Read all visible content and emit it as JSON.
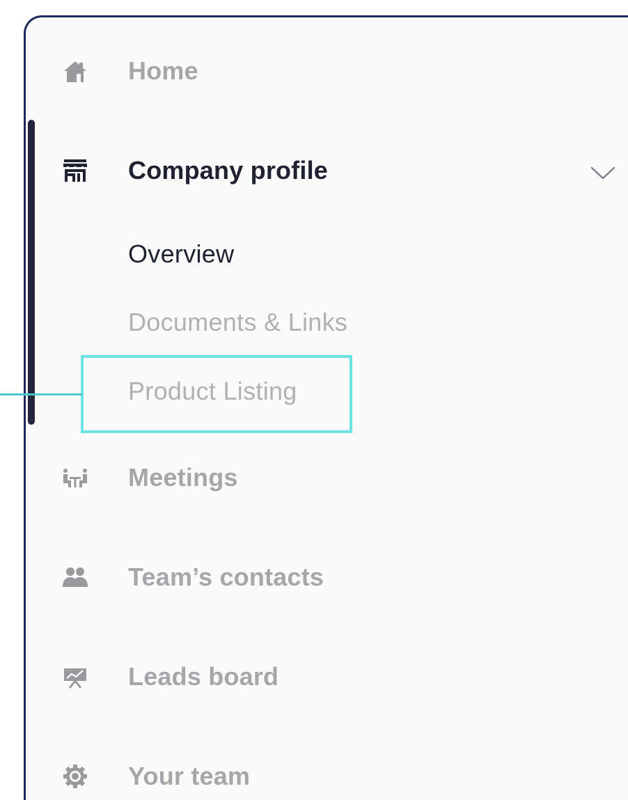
{
  "sidebar": {
    "items": [
      {
        "id": "home",
        "label": "Home",
        "icon": "home-icon",
        "active": false
      },
      {
        "id": "company-profile",
        "label": "Company profile",
        "icon": "storefront-icon",
        "active": true,
        "expanded": true
      },
      {
        "id": "meetings",
        "label": "Meetings",
        "icon": "meeting-table-icon",
        "active": false
      },
      {
        "id": "teams-contacts",
        "label": "Team’s contacts",
        "icon": "people-icon",
        "active": false
      },
      {
        "id": "leads-board",
        "label": "Leads board",
        "icon": "presentation-board-icon",
        "active": false
      },
      {
        "id": "your-team",
        "label": "Your team",
        "icon": "gear-icon",
        "active": false
      }
    ],
    "company_profile_subitems": [
      {
        "label": "Overview",
        "current": true
      },
      {
        "label": "Documents & Links",
        "current": false
      },
      {
        "label": "Product Listing",
        "current": false,
        "highlighted": true
      }
    ],
    "expand_icon": "chevron-down-icon"
  },
  "colors": {
    "active_text": "#202231",
    "inactive_text": "#a7a7ab",
    "highlight": "#6ee3e4",
    "panel_border": "#1f2a5a",
    "scroll_thumb": "#23263a"
  }
}
